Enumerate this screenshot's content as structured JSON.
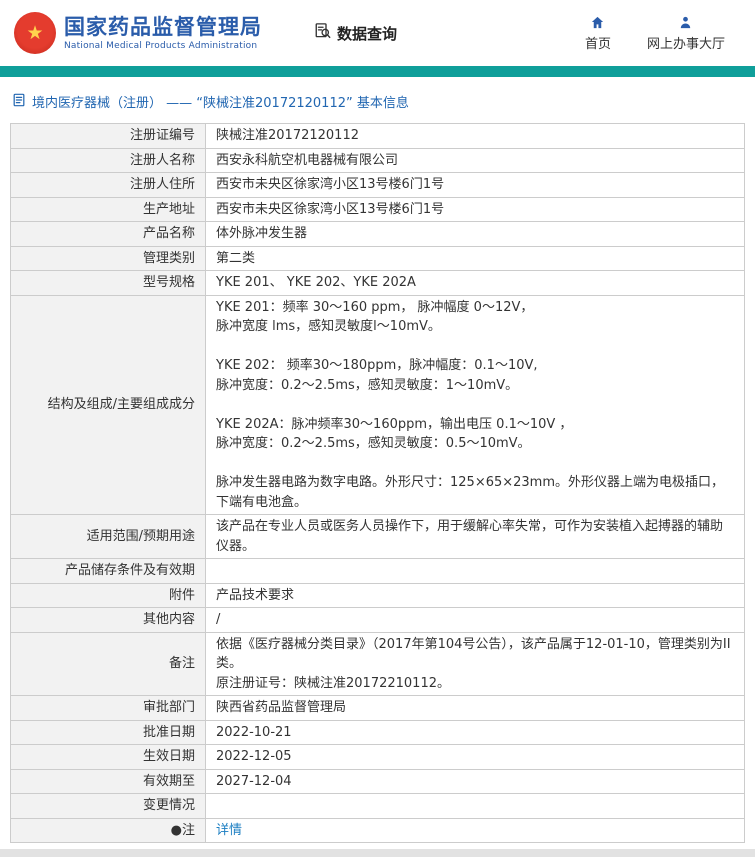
{
  "header": {
    "title": "国家药品监督管理局",
    "subtitle": "National Medical Products Administration",
    "data_query": "数据查询",
    "home": "首页",
    "hall": "网上办事大厅"
  },
  "breadcrumb": "境内医疗器械（注册） —— “陕械注准20172120112” 基本信息",
  "colors": {
    "teal_bar": "#0f9f9a",
    "title_blue": "#2a5caa",
    "breadcrumb_blue": "#2166b1",
    "link_blue": "#1b7ec2"
  },
  "table": {
    "rows": [
      {
        "label": "注册证编号",
        "value": "陕械注准20172120112"
      },
      {
        "label": "注册人名称",
        "value": "西安永科航空机电器械有限公司"
      },
      {
        "label": "注册人住所",
        "value": "西安市未央区徐家湾小区13号楼6门1号"
      },
      {
        "label": "生产地址",
        "value": "西安市未央区徐家湾小区13号楼6门1号"
      },
      {
        "label": "产品名称",
        "value": "体外脉冲发生器"
      },
      {
        "label": "管理类别",
        "value": "第二类"
      },
      {
        "label": "型号规格",
        "value": "YKE 201、 YKE 202、YKE 202A"
      },
      {
        "label": "结构及组成/主要组成成分",
        "value": "YKE 201：频率 30～160 ppm， 脉冲幅度 0～12V，\n脉冲宽度 lms，感知灵敏度l～10mV。\n\nYKE 202： 频率30～180ppm，脉冲幅度：0.1～10V,\n脉冲宽度：0.2～2.5ms，感知灵敏度：1～10mV。\n\nYKE 202A：脉冲频率30～160ppm，输出电压 0.1～10V ，\n脉冲宽度：0.2～2.5ms，感知灵敏度：0.5～10mV。\n\n脉冲发生器电路为数字电路。外形尺寸：125×65×23mm。外形仪器上端为电极插口，下端有电池盒。"
      },
      {
        "label": "适用范围/预期用途",
        "value": "该产品在专业人员或医务人员操作下，用于缓解心率失常，可作为安装植入起搏器的辅助仪器。"
      },
      {
        "label": "产品储存条件及有效期",
        "value": ""
      },
      {
        "label": "附件",
        "value": "产品技术要求"
      },
      {
        "label": "其他内容",
        "value": "/"
      },
      {
        "label": "备注",
        "value": "依据《医疗器械分类目录》（2017年第104号公告），该产品属于12-01-10，管理类别为II类。\n原注册证号：陕械注准20172210112。"
      },
      {
        "label": "审批部门",
        "value": "陕西省药品监督管理局"
      },
      {
        "label": "批准日期",
        "value": "2022-10-21"
      },
      {
        "label": "生效日期",
        "value": "2022-12-05"
      },
      {
        "label": "有效期至",
        "value": "2027-12-04"
      },
      {
        "label": "变更情况",
        "value": ""
      },
      {
        "label": "●注",
        "value": "详情",
        "link": true
      }
    ]
  }
}
